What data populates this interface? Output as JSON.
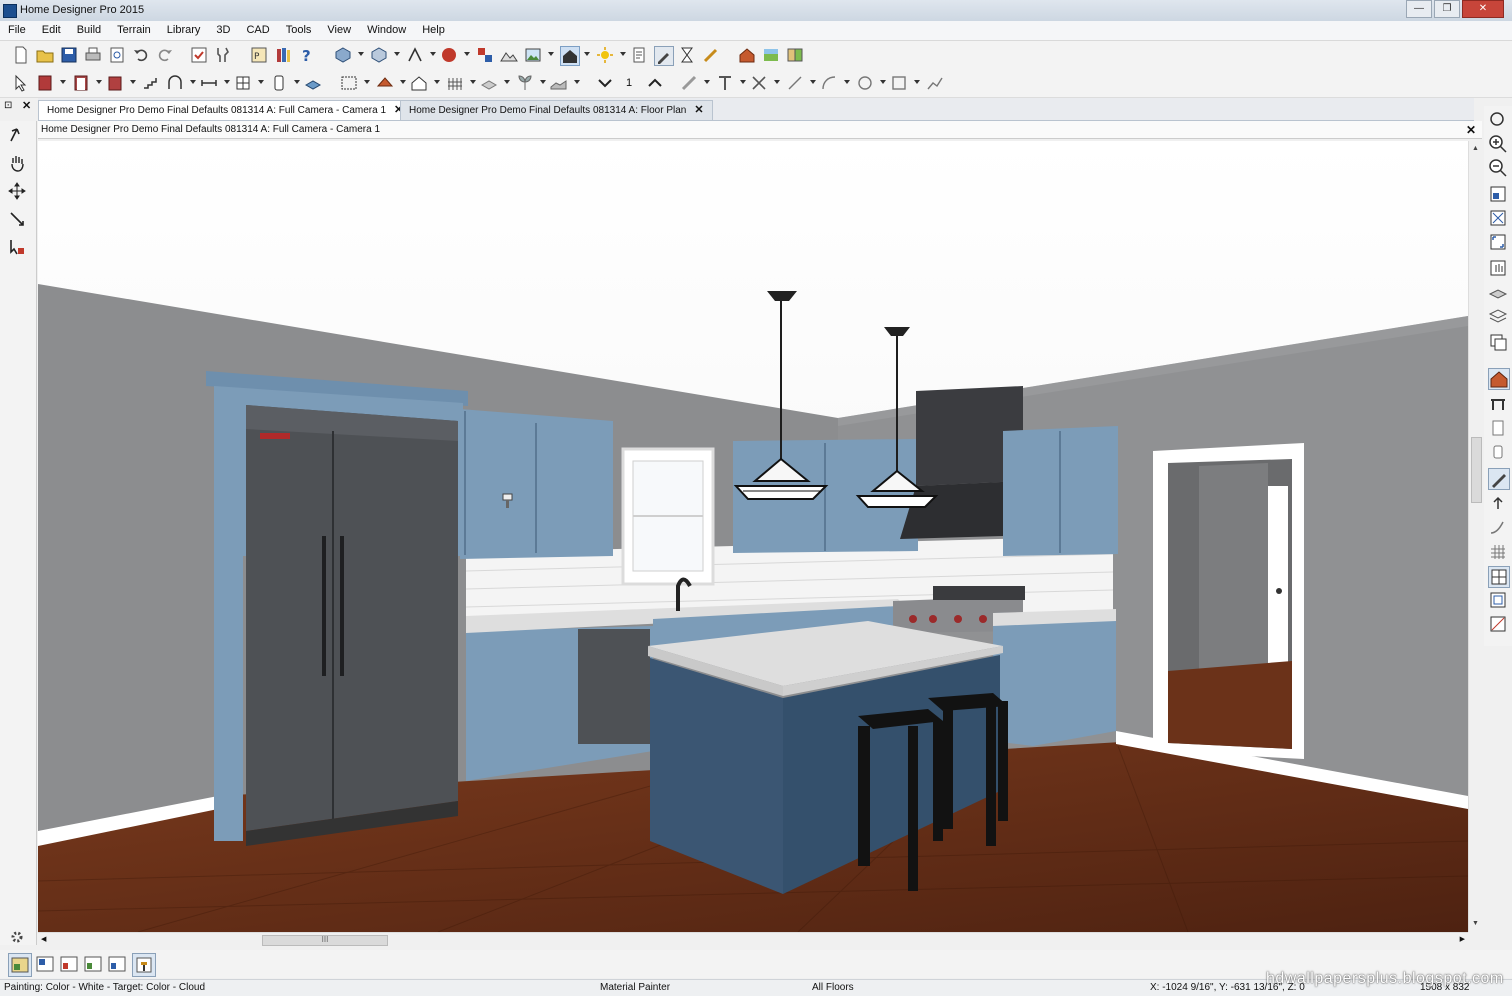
{
  "window": {
    "title": "Home Designer Pro 2015",
    "min_glyph": "—",
    "max_glyph": "❐",
    "close_glyph": "✕"
  },
  "menu": [
    "File",
    "Edit",
    "Build",
    "Terrain",
    "Library",
    "3D",
    "CAD",
    "Tools",
    "View",
    "Window",
    "Help"
  ],
  "tabs": [
    {
      "label": "Home Designer Pro Demo Final Defaults 081314 A: Full Camera - Camera 1",
      "close": "✕",
      "active": true
    },
    {
      "label": "Home Designer Pro Demo Final Defaults 081314 A: Floor Plan",
      "close": "✕",
      "active": false
    }
  ],
  "pin_glyph": "⊡",
  "pin_close": "✕",
  "view": {
    "title": "Home Designer Pro Demo Final Defaults 081314 A: Full Camera - Camera 1",
    "close": "✕"
  },
  "toolbar2": {
    "floor_number": "1"
  },
  "hscroll_grip": "III",
  "status": {
    "painting": "Painting: Color - White - Target: Color - Cloud",
    "mode": "Material Painter",
    "floors": "All Floors",
    "coords": "X: -1024 9/16\", Y: -631 13/16\", Z: 0",
    "size": "1508 x 832"
  },
  "watermark": "hdwallpapersplus.blogspot.com",
  "colors": {
    "wall": "#8d8e90",
    "cabinet": "#7c9cb8",
    "island": "#3b5673",
    "floor": "#6b3219",
    "countertop": "#dedede",
    "appliance": "#4e5155",
    "backsplash": "#f4f4f4"
  }
}
